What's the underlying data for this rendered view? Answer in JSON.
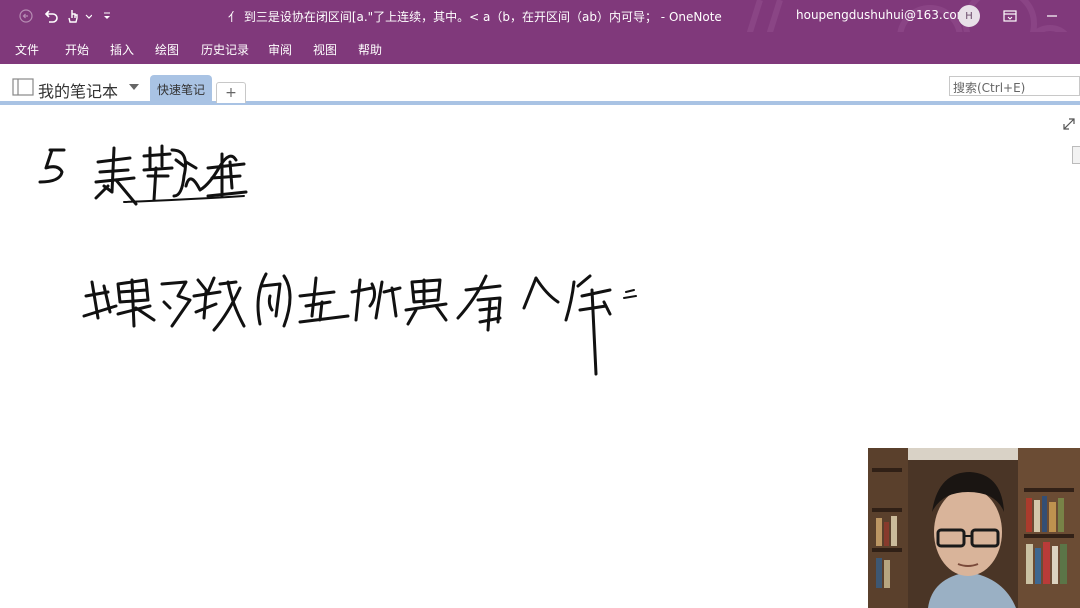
{
  "window": {
    "title": "亻 到三是设协在闭区间[a.\"了上连续，其中。< a（b，在开区间（ab）内可导；  -  OneNote",
    "account": "houpengdushuhui@163.com",
    "avatar_initial": "H",
    "accent_color": "#80397b"
  },
  "menu": {
    "items": [
      "文件",
      "开始",
      "插入",
      "绘图",
      "历史记录",
      "审阅",
      "视图",
      "帮助"
    ]
  },
  "notebook": {
    "name": "我的笔记本",
    "active_section": "快速笔记",
    "add_tab": "+"
  },
  "search": {
    "placeholder": "搜索(Ctrl+E)"
  },
  "icons": {
    "back": "back-arrow-icon",
    "undo": "undo-icon",
    "touch": "touch-mode-icon",
    "customize": "customize-qat-icon",
    "notebook": "notebook-icon",
    "expand": "expand-icon",
    "restore": "ribbon-display-icon",
    "minimize": "minimize-icon"
  }
}
